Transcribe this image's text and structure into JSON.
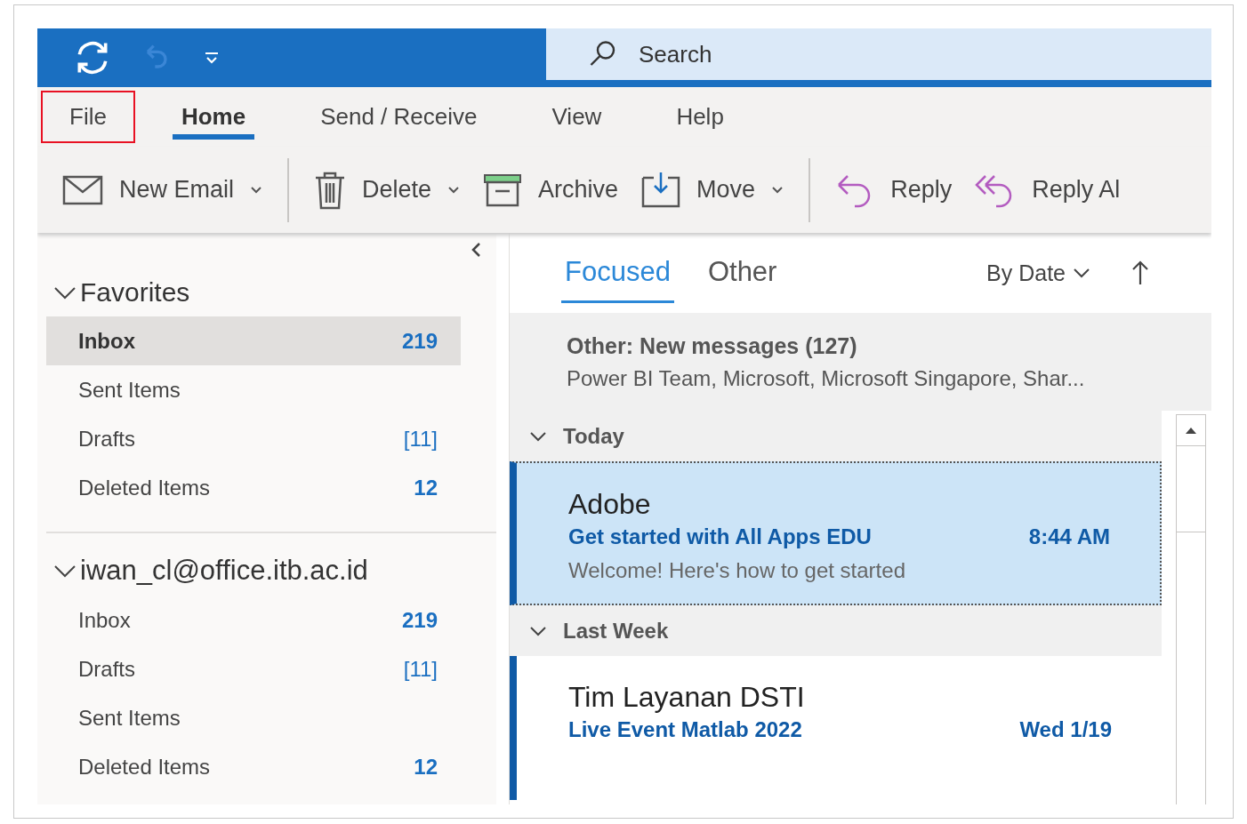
{
  "title_bar": {
    "search": {
      "placeholder": "Search"
    },
    "undo_disabled": true
  },
  "tabs": [
    {
      "label": "File",
      "selected": false,
      "highlighted": true
    },
    {
      "label": "Home",
      "selected": true,
      "highlighted": false
    },
    {
      "label": "Send / Receive",
      "selected": false,
      "highlighted": false
    },
    {
      "label": "View",
      "selected": false,
      "highlighted": false
    },
    {
      "label": "Help",
      "selected": false,
      "highlighted": false
    }
  ],
  "ribbon": [
    {
      "kind": "new-email",
      "label": "New Email",
      "dropdown": true
    },
    {
      "kind": "separator"
    },
    {
      "kind": "delete",
      "label": "Delete",
      "dropdown": true
    },
    {
      "kind": "archive",
      "label": "Archive",
      "dropdown": false
    },
    {
      "kind": "move",
      "label": "Move",
      "dropdown": true
    },
    {
      "kind": "separator"
    },
    {
      "kind": "reply",
      "label": "Reply",
      "dropdown": false
    },
    {
      "kind": "reply-all",
      "label": "Reply Al",
      "dropdown": false
    }
  ],
  "sidebar": {
    "groups": [
      {
        "title": "Favorites",
        "expanded": true,
        "items": [
          {
            "label": "Inbox",
            "count": "219",
            "kind": "unread",
            "selected": true
          },
          {
            "label": "Sent Items",
            "selected": false
          },
          {
            "label": "Drafts",
            "count": "[11]",
            "kind": "draft",
            "selected": false
          },
          {
            "label": "Deleted Items",
            "count": "12",
            "kind": "unread",
            "selected": false
          }
        ]
      },
      {
        "title": "iwan_cl@office.itb.ac.id",
        "expanded": true,
        "items": [
          {
            "label": "Inbox",
            "count": "219",
            "kind": "unread",
            "selected": false
          },
          {
            "label": "Drafts",
            "count": "[11]",
            "kind": "draft",
            "selected": false
          },
          {
            "label": "Sent Items",
            "selected": false
          },
          {
            "label": "Deleted Items",
            "count": "12",
            "kind": "unread",
            "selected": false
          }
        ]
      }
    ]
  },
  "message_list": {
    "tabs": [
      {
        "label": "Focused",
        "selected": true
      },
      {
        "label": "Other",
        "selected": false
      }
    ],
    "sort": "By Date",
    "other_banner": {
      "title": "Other: New messages (127)",
      "senders": "Power BI Team, Microsoft, Microsoft Singapore, Shar..."
    },
    "groups": [
      {
        "title": "Today",
        "expanded": true,
        "messages": [
          {
            "sender": "Adobe",
            "subject": "Get started with All Apps EDU",
            "time": "8:44 AM",
            "preview": "Welcome! Here's how to get started",
            "unread": true,
            "selected": true
          }
        ]
      },
      {
        "title": "Last Week",
        "expanded": true,
        "messages": [
          {
            "sender": "Tim Layanan DSTI",
            "subject": "Live Event Matlab 2022",
            "time": "Wed 1/19",
            "unread": true,
            "selected": false
          }
        ]
      }
    ]
  }
}
